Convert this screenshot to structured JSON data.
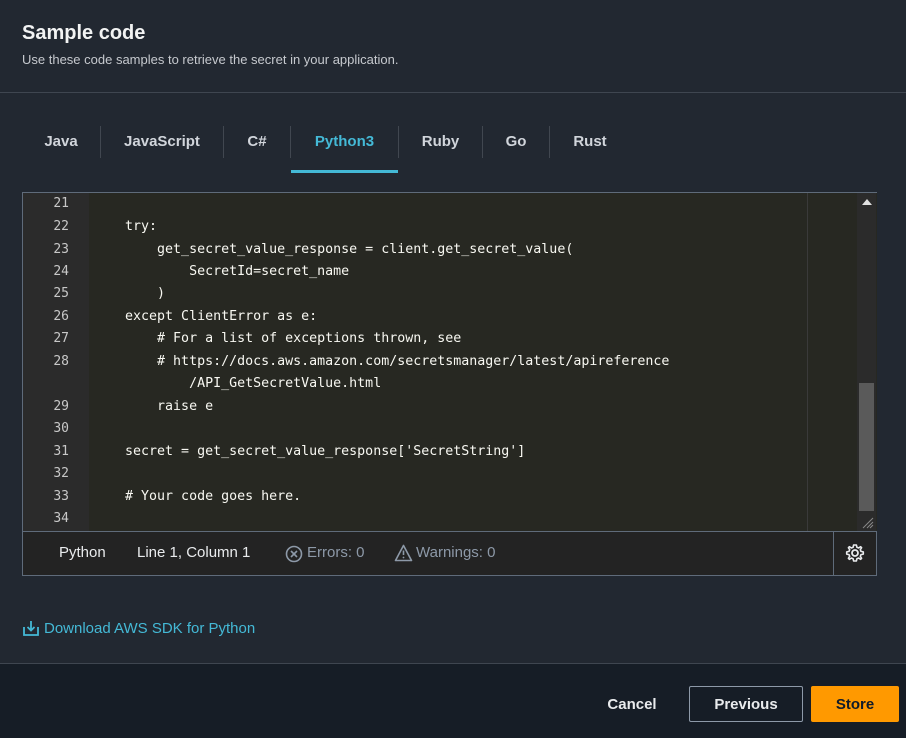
{
  "header": {
    "title": "Sample code",
    "subtitle": "Use these code samples to retrieve the secret in your application."
  },
  "tabs": [
    {
      "label": "Java"
    },
    {
      "label": "JavaScript"
    },
    {
      "label": "C#"
    },
    {
      "label": "Python3",
      "active": true
    },
    {
      "label": "Ruby"
    },
    {
      "label": "Go"
    },
    {
      "label": "Rust"
    }
  ],
  "editor": {
    "line_numbers": [
      "21",
      "22",
      "23",
      "24",
      "25",
      "26",
      "27",
      "28",
      "",
      "29",
      "30",
      "31",
      "32",
      "33",
      "34"
    ],
    "code_lines": [
      "",
      "    try:",
      "        get_secret_value_response = client.get_secret_value(",
      "            SecretId=secret_name",
      "        )",
      "    except ClientError as e:",
      "        # For a list of exceptions thrown, see",
      "        # https://docs.aws.amazon.com/secretsmanager/latest/apireference",
      "            /API_GetSecretValue.html",
      "        raise e",
      "",
      "    secret = get_secret_value_response['SecretString']",
      "",
      "    # Your code goes here.",
      ""
    ],
    "status": {
      "language": "Python",
      "position": "Line 1, Column 1",
      "errors": "Errors: 0",
      "warnings": "Warnings: 0"
    }
  },
  "download_link": "Download AWS SDK for Python",
  "footer": {
    "cancel": "Cancel",
    "previous": "Previous",
    "store": "Store"
  },
  "colors": {
    "accent": "#44b9d6",
    "primary_button": "#ff9900"
  }
}
